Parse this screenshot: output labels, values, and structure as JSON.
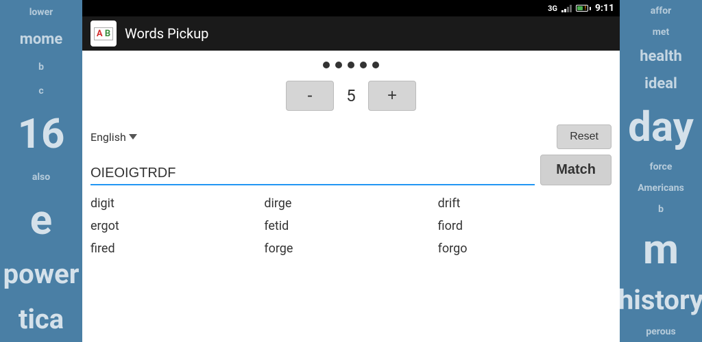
{
  "status_bar": {
    "network": "3G",
    "time": "9:11"
  },
  "toolbar": {
    "title": "Words Pickup",
    "icon_letters": [
      "A",
      "B"
    ]
  },
  "page_indicator": {
    "dots": 5
  },
  "counter": {
    "value": "5",
    "minus_label": "-",
    "plus_label": "+"
  },
  "language": {
    "label": "English"
  },
  "buttons": {
    "reset": "Reset",
    "match": "Match"
  },
  "input": {
    "value": "OIEOIGTRDF",
    "placeholder": ""
  },
  "results": [
    {
      "word": "digit"
    },
    {
      "word": "dirge"
    },
    {
      "word": "drift"
    },
    {
      "word": "ergot"
    },
    {
      "word": "fetid"
    },
    {
      "word": "fiord"
    },
    {
      "word": "fired"
    },
    {
      "word": "forge"
    },
    {
      "word": "forgo"
    }
  ],
  "bg_left_words": [
    "lower",
    "mome",
    "b",
    "c",
    "16",
    "also",
    "e",
    "power",
    "tica"
  ],
  "bg_right_words": [
    "affor",
    "met",
    "health",
    "ideal",
    "day",
    "force",
    "Americans",
    "b",
    "m",
    "history",
    "perous"
  ]
}
